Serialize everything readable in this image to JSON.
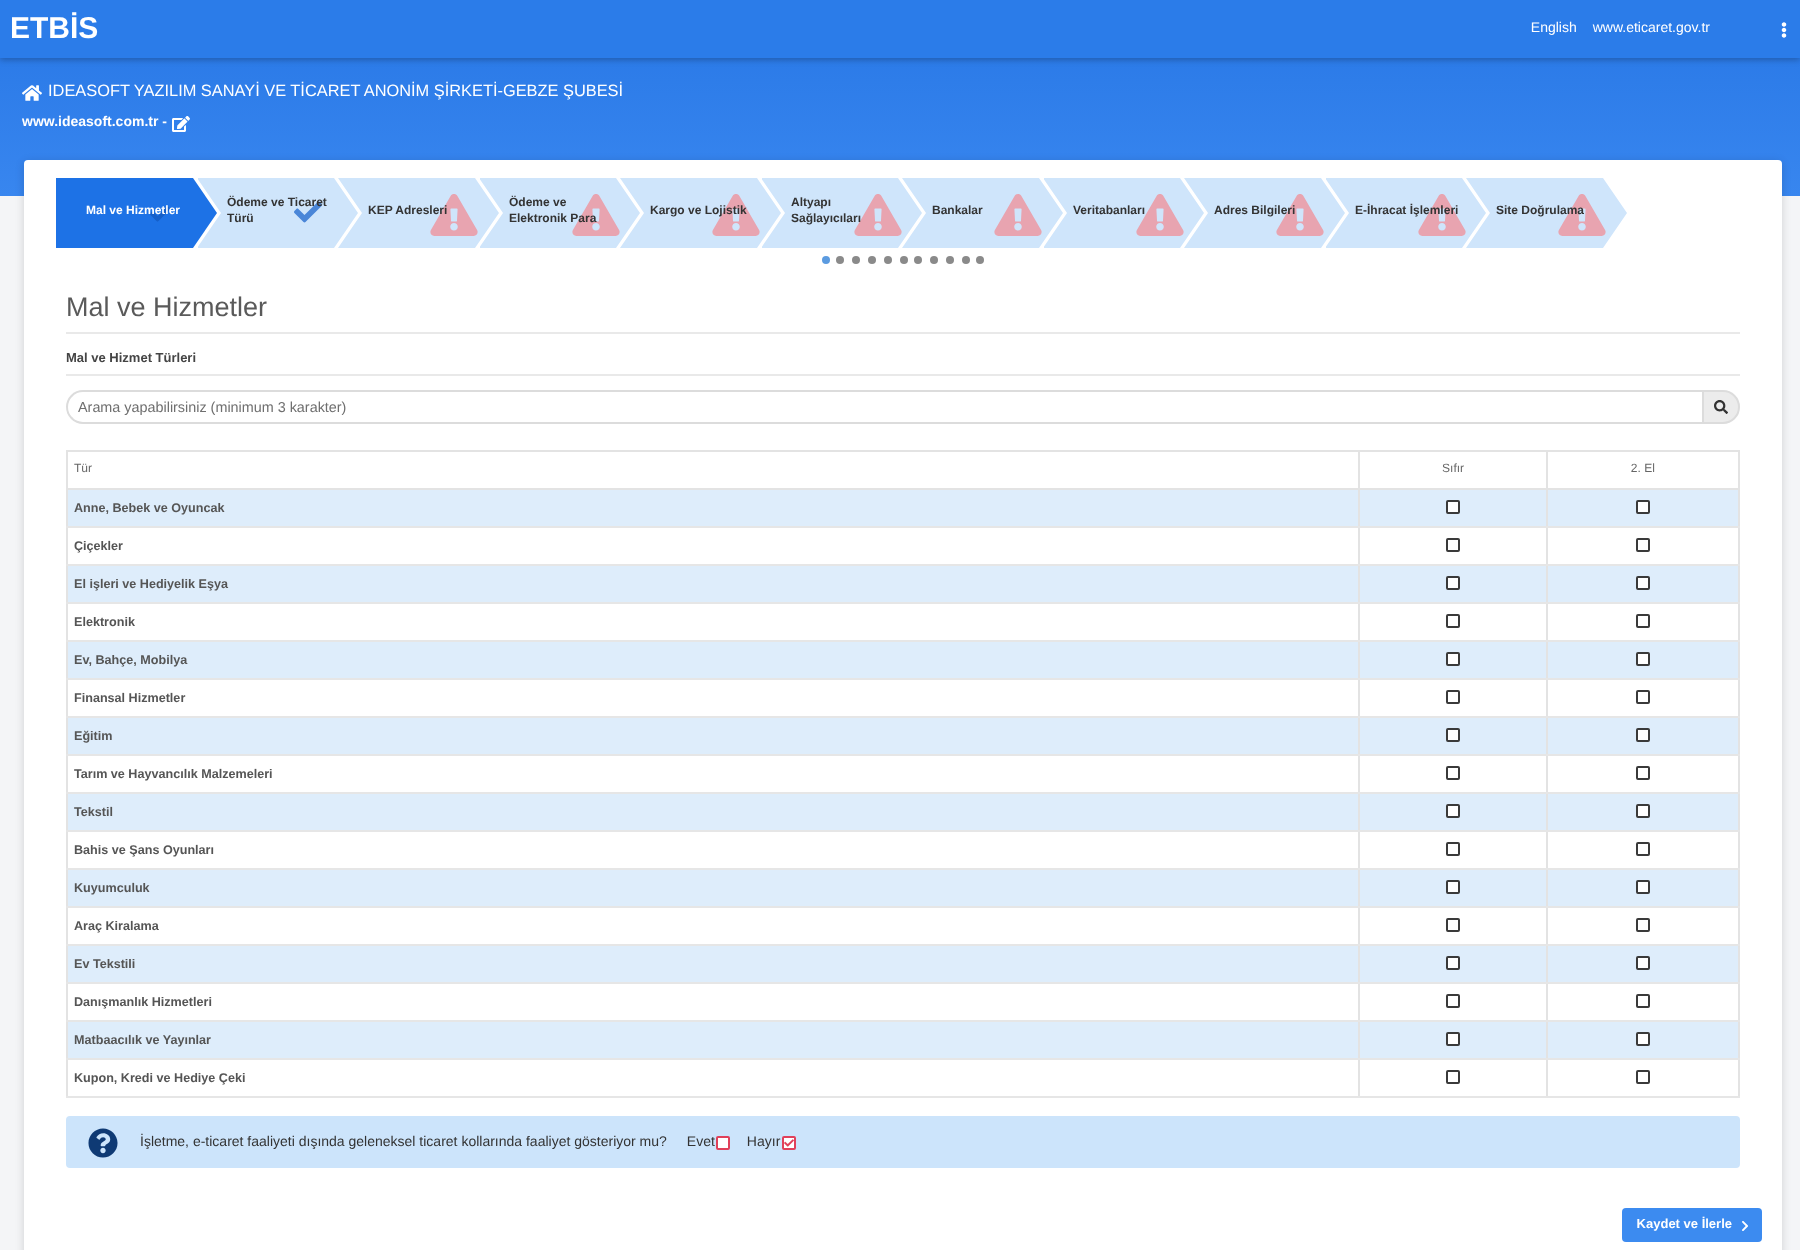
{
  "header": {
    "logo": "ETBİS",
    "links": [
      "English",
      "www.eticaret.gov.tr"
    ]
  },
  "company": {
    "name": "IDEASOFT YAZILIM SANAYİ VE TİCARET ANONİM ŞİRKETİ-GEBZE ŞUBESİ",
    "website": "www.ideasoft.com.tr -"
  },
  "steps": [
    {
      "label": "Mal ve Hizmetler",
      "selected": true,
      "kind": "complete"
    },
    {
      "label": "Ödeme ve Ticaret Türü",
      "selected": false,
      "kind": "complete"
    },
    {
      "label": "KEP Adresleri",
      "selected": false,
      "kind": "warning"
    },
    {
      "label": "Ödeme ve Elektronik Para",
      "selected": false,
      "kind": "warning"
    },
    {
      "label": "Kargo ve Lojistik",
      "selected": false,
      "kind": "warning"
    },
    {
      "label": "Altyapı Sağlayıcıları",
      "selected": false,
      "kind": "warning"
    },
    {
      "label": "Bankalar",
      "selected": false,
      "kind": "warning"
    },
    {
      "label": "Veritabanları",
      "selected": false,
      "kind": "warning"
    },
    {
      "label": "Adres Bilgileri",
      "selected": false,
      "kind": "warning"
    },
    {
      "label": "E-İhracat İşlemleri",
      "selected": false,
      "kind": "warning"
    },
    {
      "label": "Site Doğrulama",
      "selected": false,
      "kind": "warning"
    }
  ],
  "pager_dots": [
    {
      "selected": true
    },
    {
      "selected": false
    },
    {
      "selected": false
    },
    {
      "selected": false
    },
    {
      "selected": false
    },
    {
      "selected": false
    },
    {
      "selected": false
    },
    {
      "selected": false
    },
    {
      "selected": false
    },
    {
      "selected": false
    },
    {
      "selected": false
    }
  ],
  "section": {
    "title": "Mal ve Hizmetler",
    "subtitle": "Mal ve Hizmet Türleri"
  },
  "search": {
    "placeholder": "Arama yapabilirsiniz (minimum 3 karakter)"
  },
  "table": {
    "columns": [
      "Tür",
      "Sıfır",
      "2. El"
    ],
    "rows": [
      {
        "name": "Anne, Bebek ve Oyuncak",
        "new": false,
        "second_hand": false
      },
      {
        "name": "Çiçekler",
        "new": false,
        "second_hand": false
      },
      {
        "name": "El işleri ve Hediyelik Eşya",
        "new": false,
        "second_hand": false
      },
      {
        "name": "Elektronik",
        "new": false,
        "second_hand": false
      },
      {
        "name": "Ev, Bahçe, Mobilya",
        "new": false,
        "second_hand": false
      },
      {
        "name": "Finansal Hizmetler",
        "new": false,
        "second_hand": false
      },
      {
        "name": "Eğitim",
        "new": false,
        "second_hand": false
      },
      {
        "name": "Tarım ve Hayvancılık Malzemeleri",
        "new": false,
        "second_hand": false
      },
      {
        "name": "Tekstil",
        "new": false,
        "second_hand": false
      },
      {
        "name": "Bahis ve Şans Oyunları",
        "new": false,
        "second_hand": false
      },
      {
        "name": "Kuyumculuk",
        "new": false,
        "second_hand": false
      },
      {
        "name": "Araç Kiralama",
        "new": false,
        "second_hand": false
      },
      {
        "name": "Ev Tekstili",
        "new": false,
        "second_hand": false
      },
      {
        "name": "Danışmanlık Hizmetleri",
        "new": false,
        "second_hand": false
      },
      {
        "name": "Matbaacılık ve Yayınlar",
        "new": false,
        "second_hand": false
      },
      {
        "name": "Kupon, Kredi ve Hediye Çeki",
        "new": false,
        "second_hand": false
      }
    ]
  },
  "question": {
    "text": "İşletme, e-ticaret faaliyeti dışında geleneksel ticaret kollarında faaliyet gösteriyor mu?",
    "options": [
      {
        "label": "Evet",
        "checked": false
      },
      {
        "label": "Hayır",
        "checked": true
      }
    ]
  },
  "submit_button": "Kaydet ve İlerle"
}
